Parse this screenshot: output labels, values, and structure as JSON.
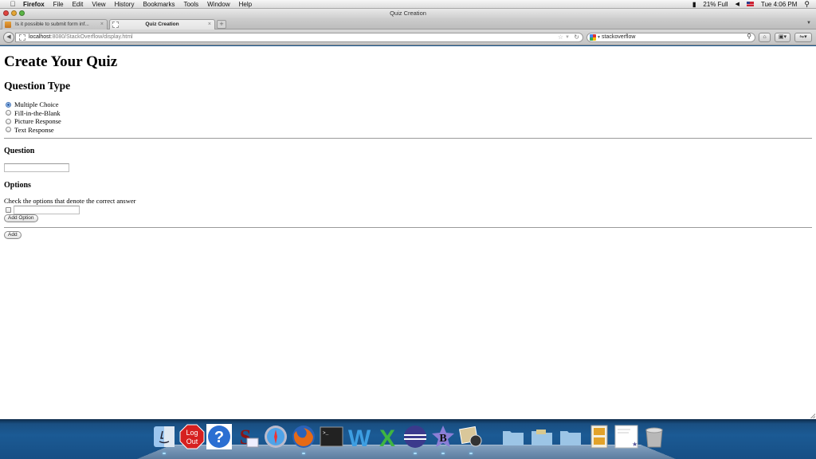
{
  "menubar": {
    "app_name": "Firefox",
    "items": [
      "File",
      "Edit",
      "View",
      "History",
      "Bookmarks",
      "Tools",
      "Window",
      "Help"
    ],
    "status": {
      "battery": "21% Full",
      "clock": "Tue 4:06 PM"
    }
  },
  "window": {
    "title": "Quiz Creation"
  },
  "tabs": [
    {
      "label": "Is it possible to submit form inf...",
      "active": false
    },
    {
      "label": "Quiz Creation",
      "active": true
    }
  ],
  "navbar": {
    "url_host": "localhost",
    "url_rest": ":8080/StackOverflow/display.html",
    "search_value": "stackoverflow"
  },
  "page": {
    "title": "Create Your Quiz",
    "question_type_heading": "Question Type",
    "question_types": [
      {
        "label": "Multiple Choice",
        "checked": true
      },
      {
        "label": "Fill-in-the-Blank",
        "checked": false
      },
      {
        "label": "Picture Response",
        "checked": false
      },
      {
        "label": "Text Response",
        "checked": false
      }
    ],
    "question_heading": "Question",
    "question_value": "",
    "options_heading": "Options",
    "options_hint": "Check the options that denote the correct answer",
    "option_value": "",
    "option_checked": false,
    "add_option_label": "Add Option",
    "add_label": "Add"
  },
  "dock": {
    "items": [
      {
        "name": "Finder",
        "running": true
      },
      {
        "name": "Log Out",
        "label": "Log Out",
        "running": false
      },
      {
        "name": "Help",
        "running": false
      },
      {
        "name": "Stanford Mail",
        "running": false
      },
      {
        "name": "Safari",
        "running": false
      },
      {
        "name": "Firefox",
        "running": true
      },
      {
        "name": "Terminal",
        "running": false
      },
      {
        "name": "Word",
        "running": false
      },
      {
        "name": "Excel",
        "running": false
      },
      {
        "name": "Eclipse",
        "running": true
      },
      {
        "name": "BBEdit",
        "running": true
      },
      {
        "name": "Preview",
        "running": true
      },
      {
        "name": "Applications",
        "running": false
      },
      {
        "name": "Documents",
        "running": false
      },
      {
        "name": "Downloads",
        "running": false
      },
      {
        "name": "Photo Booth Stack",
        "running": false
      },
      {
        "name": "Document Stack",
        "running": false
      },
      {
        "name": "Trash",
        "running": false
      }
    ]
  }
}
